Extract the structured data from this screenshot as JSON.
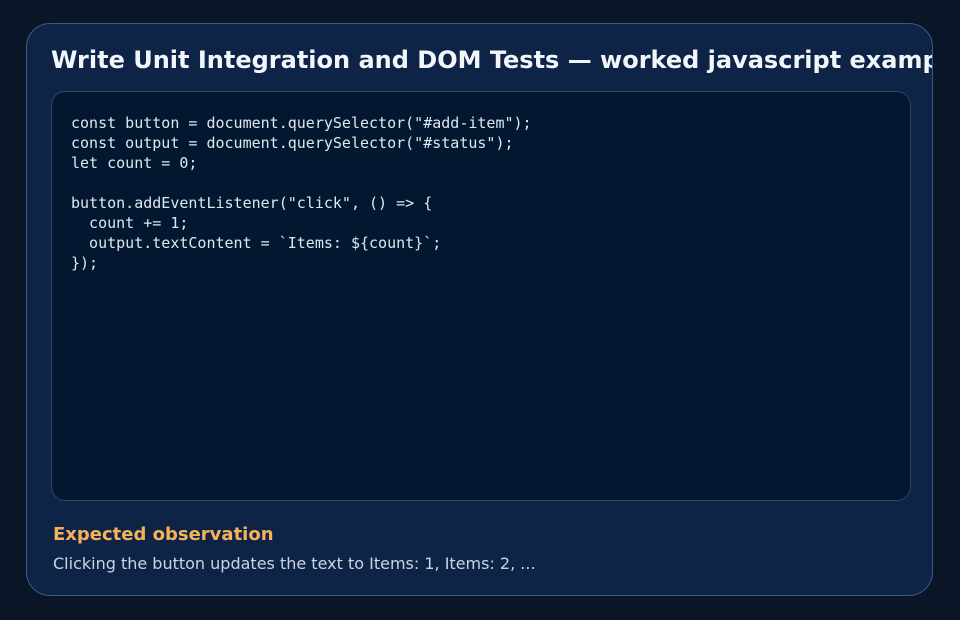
{
  "card": {
    "title": "Write Unit Integration and DOM Tests — worked javascript example",
    "code": "const button = document.querySelector(\"#add-item\");\nconst output = document.querySelector(\"#status\");\nlet count = 0;\n\nbutton.addEventListener(\"click\", () => {\n  count += 1;\n  output.textContent = `Items: ${count}`;\n});",
    "observation": {
      "heading": "Expected observation",
      "text": "Clicking the button updates the text to Items: 1, Items: 2, ..."
    }
  },
  "colors": {
    "background": "#0a1628",
    "card": "#0e2447",
    "code_panel": "#031830",
    "accent": "#f5b25a"
  }
}
